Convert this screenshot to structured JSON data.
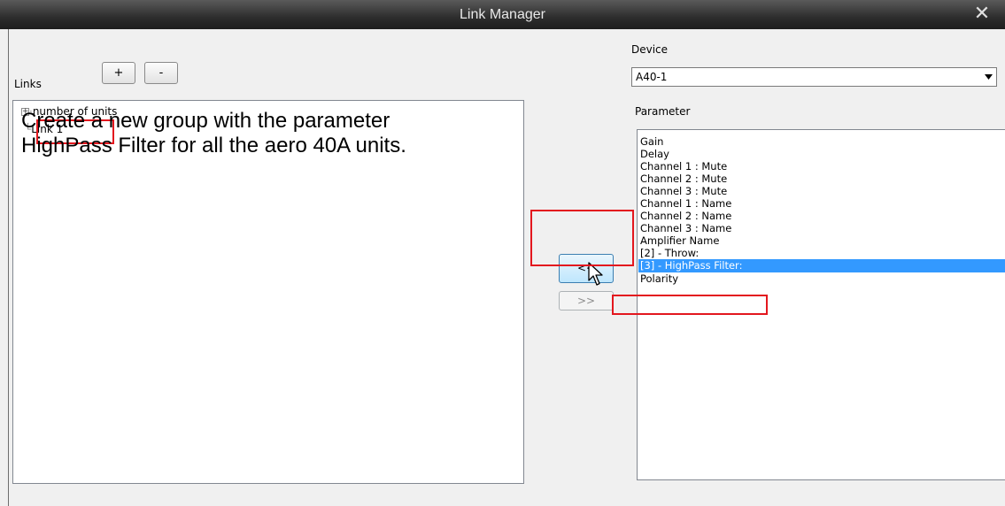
{
  "window": {
    "title": "Link Manager",
    "close_glyph": "✕"
  },
  "links": {
    "label": "Links",
    "add_label": "+",
    "remove_label": "-",
    "tree": [
      {
        "label": "number of units",
        "expander": "+"
      },
      {
        "label": "Link 1"
      }
    ]
  },
  "instruction": "Create a new group with the parameter HighPass Filter for all the aero 40A units.",
  "move_buttons": {
    "add_label": "<<",
    "remove_label": ">>"
  },
  "device": {
    "label": "Device",
    "value": "A40-1"
  },
  "parameter": {
    "label": "Parameter",
    "items": [
      "Gain",
      "Delay",
      "Channel 1 : Mute",
      "Channel 2 : Mute",
      "Channel 3 : Mute",
      "Channel 1 : Name",
      "Channel 2 : Name",
      "Channel 3 : Name",
      "Amplifier Name",
      "[2] - Throw:",
      "[3] - HighPass Filter:",
      "Polarity"
    ],
    "selected_index": 10
  },
  "colors": {
    "highlight_red": "#e3171e",
    "selection_blue": "#3399ff"
  }
}
